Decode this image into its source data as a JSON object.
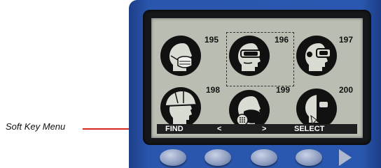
{
  "callout": {
    "label": "Soft Key Menu"
  },
  "icons": [
    {
      "number": "195",
      "icon": "face-mask-icon"
    },
    {
      "number": "196",
      "icon": "safety-goggles-icon",
      "selected": true
    },
    {
      "number": "197",
      "icon": "face-shield-goggles-icon"
    },
    {
      "number": "198",
      "icon": "hard-hat-icon"
    },
    {
      "number": "199",
      "icon": "respirator-icon"
    },
    {
      "number": "200",
      "icon": "welding-mask-icon"
    }
  ],
  "softkeys": {
    "find": "FIND",
    "prev": "<",
    "next": ">",
    "select": "SELECT"
  },
  "colors": {
    "device_blue": "#2a58b0",
    "lcd": "#b9bdb2",
    "callout_line": "#d8261c",
    "softkey_bar": "#1e1f1e"
  }
}
